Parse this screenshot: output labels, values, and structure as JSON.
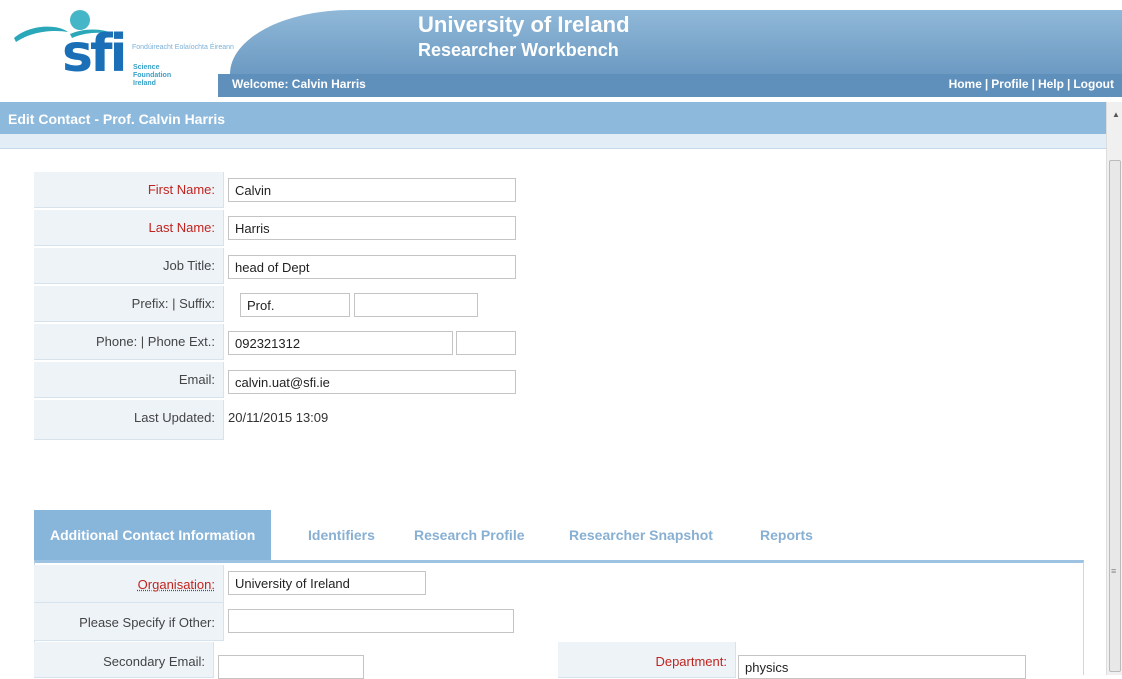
{
  "header": {
    "logo_text": "sfi",
    "logo_irish": "Fondúireacht Eolaíochta Éireann",
    "logo_english": "Science\nFoundation\nIreland",
    "title": "University of Ireland",
    "subtitle": "Researcher Workbench",
    "welcome": "Welcome: Calvin Harris",
    "nav": [
      "Home",
      "Profile",
      "Help",
      "Logout"
    ],
    "nav_separator": "|"
  },
  "page": {
    "title": "Edit Contact - Prof. Calvin Harris"
  },
  "form": {
    "first_name": {
      "label": "First Name:",
      "value": "Calvin"
    },
    "last_name": {
      "label": "Last Name:",
      "value": "Harris"
    },
    "job_title": {
      "label": "Job Title:",
      "value": "head of Dept"
    },
    "prefix_suffix": {
      "label": "Prefix: | Suffix:",
      "prefix": "Prof.",
      "suffix": ""
    },
    "phone": {
      "label": "Phone: | Phone Ext.:",
      "value": "092321312",
      "ext": ""
    },
    "email": {
      "label": "Email:",
      "value": "calvin.uat@sfi.ie"
    },
    "last_updated": {
      "label": "Last Updated:",
      "value": "20/11/2015 13:09"
    }
  },
  "tabs": [
    {
      "label": "Additional Contact Information",
      "active": true
    },
    {
      "label": "Identifiers",
      "active": false
    },
    {
      "label": "Research Profile",
      "active": false
    },
    {
      "label": "Researcher Snapshot",
      "active": false
    },
    {
      "label": "Reports",
      "active": false
    }
  ],
  "additional": {
    "organisation": {
      "label": "Organisation:",
      "value": "University of Ireland"
    },
    "specify_other": {
      "label": "Please Specify if Other:",
      "value": ""
    },
    "secondary_email": {
      "label": "Secondary Email:",
      "value": ""
    },
    "department": {
      "label": "Department:",
      "value": "physics"
    }
  },
  "colors": {
    "accent": "#88b5da",
    "required": "#c0241e",
    "brand": "#1b6fb7"
  },
  "icons": [
    "sfi-logo-swoosh",
    "scroll-up-arrow-icon",
    "scroll-grip-icon"
  ]
}
